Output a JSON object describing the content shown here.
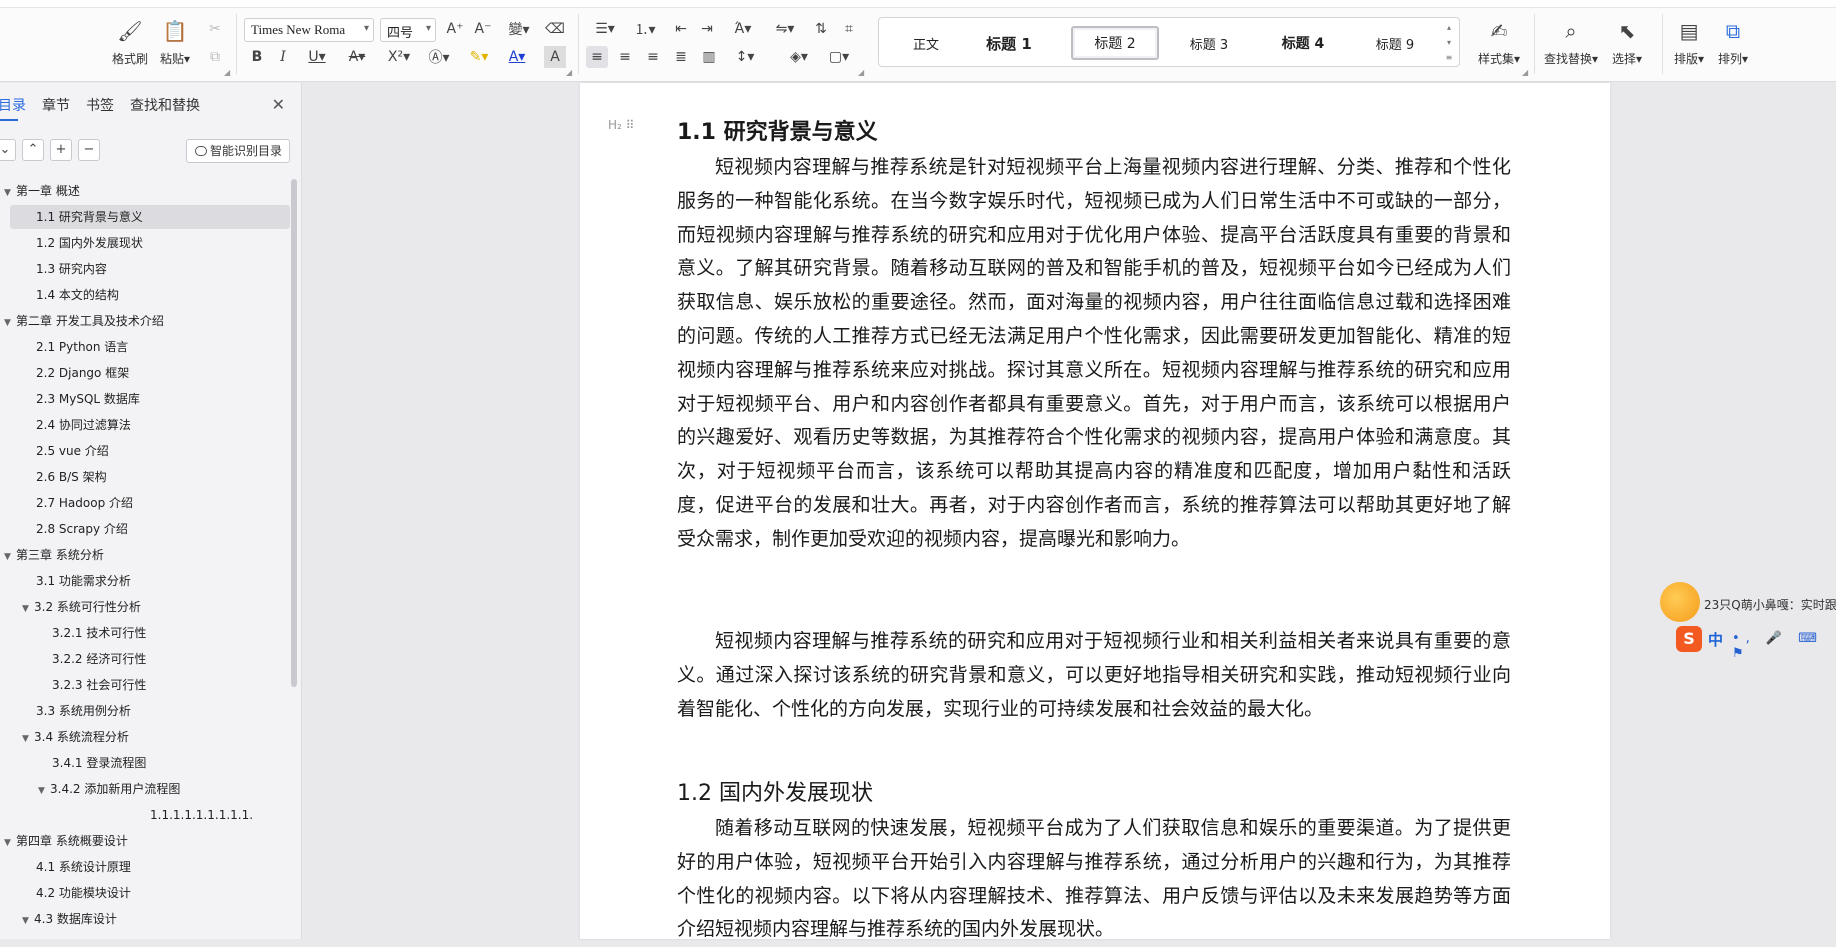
{
  "ribbon": {
    "format_painter": "格式刷",
    "paste": "粘贴",
    "font_name": "Times New Roma",
    "font_size": "四号",
    "styles": [
      "正文",
      "标题 1",
      "标题 2",
      "标题 3",
      "标题 4",
      "标题 9"
    ],
    "selected_style": "标题 2",
    "style_set": "样式集",
    "find_replace": "查找替换",
    "select": "选择",
    "layout": "排版",
    "arrange": "排列"
  },
  "nav": {
    "tabs": [
      "目录",
      "章节",
      "书签",
      "查找和替换"
    ],
    "active_tab": "目录",
    "smart_toc": "智能识别目录",
    "toc": [
      {
        "label": "第一章  概述",
        "level": 1,
        "expanded": true
      },
      {
        "label": "1.1  研究背景与意义",
        "level": 2,
        "selected": true
      },
      {
        "label": "1.2 国内外发展现状",
        "level": 2
      },
      {
        "label": "1.3  研究内容",
        "level": 2
      },
      {
        "label": "1.4 本文的结构",
        "level": 2
      },
      {
        "label": "第二章  开发工具及技术介绍",
        "level": 1,
        "expanded": true
      },
      {
        "label": "2.1 Python 语言",
        "level": 2
      },
      {
        "label": "2.2 Django 框架",
        "level": 2
      },
      {
        "label": "2.3 MySQL 数据库",
        "level": 2
      },
      {
        "label": "2.4  协同过滤算法",
        "level": 2
      },
      {
        "label": "2.5 vue 介绍",
        "level": 2
      },
      {
        "label": "2.6 B/S 架构",
        "level": 2
      },
      {
        "label": "2.7 Hadoop 介绍",
        "level": 2
      },
      {
        "label": "2.8 Scrapy 介绍",
        "level": 2
      },
      {
        "label": "第三章  系统分析",
        "level": 1,
        "expanded": true
      },
      {
        "label": "3.1 功能需求分析",
        "level": 2
      },
      {
        "label": "3.2 系统可行性分析",
        "level": 2,
        "expanded": true
      },
      {
        "label": "3.2.1 技术可行性",
        "level": 3
      },
      {
        "label": "3.2.2  经济可行性",
        "level": 3
      },
      {
        "label": "3.2.3 社会可行性",
        "level": 3
      },
      {
        "label": "3.3  系统用例分析",
        "level": 2
      },
      {
        "label": "3.4 系统流程分析",
        "level": 2,
        "expanded": true
      },
      {
        "label": "3.4.1  登录流程图",
        "level": 3
      },
      {
        "label": "3.4.2  添加新用户流程图",
        "level": 3,
        "expanded": true
      },
      {
        "label": "1.1.1.1.1.1.1.1.1.",
        "level": 4
      },
      {
        "label": "第四章  系统概要设计",
        "level": 1,
        "expanded": true
      },
      {
        "label": "4.1 系统设计原理",
        "level": 2
      },
      {
        "label": "4.2 功能模块设计",
        "level": 2
      },
      {
        "label": "4.3  数据库设计",
        "level": 2,
        "expanded": true
      }
    ]
  },
  "doc": {
    "h_1_1": "1.1  研究背景与意义",
    "p1": "短视频内容理解与推荐系统是针对短视频平台上海量视频内容进行理解、分类、推荐和个性化服务的一种智能化系统。在当今数字娱乐时代，短视频已成为人们日常生活中不可或缺的一部分，而短视频内容理解与推荐系统的研究和应用对于优化用户体验、提高平台活跃度具有重要的背景和意义。了解其研究背景。随着移动互联网的普及和智能手机的普及，短视频平台如今已经成为人们获取信息、娱乐放松的重要途径。然而，面对海量的视频内容，用户往往面临信息过载和选择困难的问题。传统的人工推荐方式已经无法满足用户个性化需求，因此需要研发更加智能化、精准的短视频内容理解与推荐系统来应对挑战。探讨其意义所在。短视频内容理解与推荐系统的研究和应用对于短视频平台、用户和内容创作者都具有重要意义。首先，对于用户而言，该系统可以根据用户的兴趣爱好、观看历史等数据，为其推荐符合个性化需求的视频内容，提高用户体验和满意度。其次，对于短视频平台而言，该系统可以帮助其提高内容的精准度和匹配度，增加用户黏性和活跃度，促进平台的发展和壮大。再者，对于内容创作者而言，系统的推荐算法可以帮助其更好地了解受众需求，制作更加受欢迎的视频内容，提高曝光和影响力。",
    "p2": "短视频内容理解与推荐系统的研究和应用对于短视频行业和相关利益相关者来说具有重要的意义。通过深入探讨该系统的研究背景和意义，可以更好地指导相关研究和实践，推动短视频行业向着智能化、个性化的方向发展，实现行业的可持续发展和社会效益的最大化。",
    "h_1_2": "1.2 国内外发展现状",
    "p3": "随着移动互联网的快速发展，短视频平台成为了人们获取信息和娱乐的重要渠道。为了提供更好的用户体验，短视频平台开始引入内容理解与推荐系统，通过分析用户的兴趣和行为，为其推荐个性化的视频内容。以下将从内容理解技术、推荐算法、用户反馈与评估以及未来发展趋势等方面介绍短视频内容理解与推荐系统的国内外发展现状。"
  },
  "widget": {
    "qq_text": "23只Q萌小鼻嘎：实时跟",
    "ime_mode": "中"
  }
}
